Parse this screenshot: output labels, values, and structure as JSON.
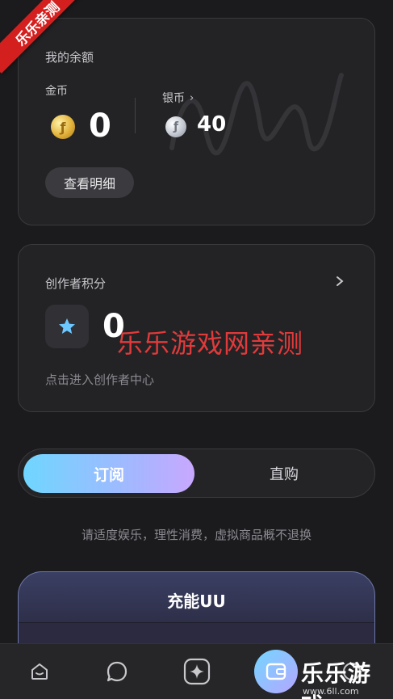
{
  "corner_badge": "乐乐亲测",
  "balance": {
    "title": "我的余额",
    "gold_label": "金币",
    "gold_value": "0",
    "silver_label": "银币",
    "silver_value": "40",
    "detail_button": "查看明细"
  },
  "creator": {
    "title": "创作者积分",
    "points": "0",
    "enter_text": "点击进入创作者中心"
  },
  "overlay_watermark": "乐乐游戏网亲测",
  "tabs": {
    "active": "订阅",
    "inactive": "直购"
  },
  "notice": "请适度娱乐，理性消费，虚拟商品概不退换",
  "recharge": {
    "title": "充能UU"
  },
  "nav": {
    "items": [
      "home-icon",
      "chat-icon",
      "sparkle-icon",
      "wallet-icon",
      "profile-icon"
    ]
  },
  "brand": {
    "logo": "乐乐游戏",
    "url": "www.6ll.com"
  },
  "colors": {
    "background": "#1b1b1e",
    "card": "#232326",
    "accent_start": "#6fd6ff",
    "accent_end": "#c9a8ff",
    "watermark_red": "#e23a3a",
    "badge_red": "#d41f1f"
  }
}
